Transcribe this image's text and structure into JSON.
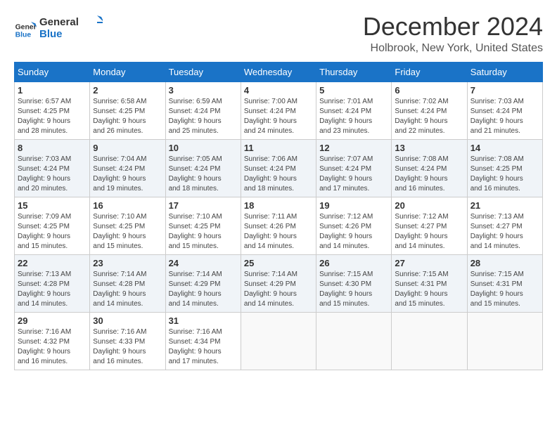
{
  "header": {
    "logo_line1": "General",
    "logo_line2": "Blue",
    "main_title": "December 2024",
    "subtitle": "Holbrook, New York, United States"
  },
  "calendar": {
    "days_of_week": [
      "Sunday",
      "Monday",
      "Tuesday",
      "Wednesday",
      "Thursday",
      "Friday",
      "Saturday"
    ],
    "weeks": [
      [
        {
          "day": 1,
          "info": "Sunrise: 6:57 AM\nSunset: 4:25 PM\nDaylight: 9 hours\nand 28 minutes."
        },
        {
          "day": 2,
          "info": "Sunrise: 6:58 AM\nSunset: 4:25 PM\nDaylight: 9 hours\nand 26 minutes."
        },
        {
          "day": 3,
          "info": "Sunrise: 6:59 AM\nSunset: 4:24 PM\nDaylight: 9 hours\nand 25 minutes."
        },
        {
          "day": 4,
          "info": "Sunrise: 7:00 AM\nSunset: 4:24 PM\nDaylight: 9 hours\nand 24 minutes."
        },
        {
          "day": 5,
          "info": "Sunrise: 7:01 AM\nSunset: 4:24 PM\nDaylight: 9 hours\nand 23 minutes."
        },
        {
          "day": 6,
          "info": "Sunrise: 7:02 AM\nSunset: 4:24 PM\nDaylight: 9 hours\nand 22 minutes."
        },
        {
          "day": 7,
          "info": "Sunrise: 7:03 AM\nSunset: 4:24 PM\nDaylight: 9 hours\nand 21 minutes."
        }
      ],
      [
        {
          "day": 8,
          "info": "Sunrise: 7:03 AM\nSunset: 4:24 PM\nDaylight: 9 hours\nand 20 minutes."
        },
        {
          "day": 9,
          "info": "Sunrise: 7:04 AM\nSunset: 4:24 PM\nDaylight: 9 hours\nand 19 minutes."
        },
        {
          "day": 10,
          "info": "Sunrise: 7:05 AM\nSunset: 4:24 PM\nDaylight: 9 hours\nand 18 minutes."
        },
        {
          "day": 11,
          "info": "Sunrise: 7:06 AM\nSunset: 4:24 PM\nDaylight: 9 hours\nand 18 minutes."
        },
        {
          "day": 12,
          "info": "Sunrise: 7:07 AM\nSunset: 4:24 PM\nDaylight: 9 hours\nand 17 minutes."
        },
        {
          "day": 13,
          "info": "Sunrise: 7:08 AM\nSunset: 4:24 PM\nDaylight: 9 hours\nand 16 minutes."
        },
        {
          "day": 14,
          "info": "Sunrise: 7:08 AM\nSunset: 4:25 PM\nDaylight: 9 hours\nand 16 minutes."
        }
      ],
      [
        {
          "day": 15,
          "info": "Sunrise: 7:09 AM\nSunset: 4:25 PM\nDaylight: 9 hours\nand 15 minutes."
        },
        {
          "day": 16,
          "info": "Sunrise: 7:10 AM\nSunset: 4:25 PM\nDaylight: 9 hours\nand 15 minutes."
        },
        {
          "day": 17,
          "info": "Sunrise: 7:10 AM\nSunset: 4:25 PM\nDaylight: 9 hours\nand 15 minutes."
        },
        {
          "day": 18,
          "info": "Sunrise: 7:11 AM\nSunset: 4:26 PM\nDaylight: 9 hours\nand 14 minutes."
        },
        {
          "day": 19,
          "info": "Sunrise: 7:12 AM\nSunset: 4:26 PM\nDaylight: 9 hours\nand 14 minutes."
        },
        {
          "day": 20,
          "info": "Sunrise: 7:12 AM\nSunset: 4:27 PM\nDaylight: 9 hours\nand 14 minutes."
        },
        {
          "day": 21,
          "info": "Sunrise: 7:13 AM\nSunset: 4:27 PM\nDaylight: 9 hours\nand 14 minutes."
        }
      ],
      [
        {
          "day": 22,
          "info": "Sunrise: 7:13 AM\nSunset: 4:28 PM\nDaylight: 9 hours\nand 14 minutes."
        },
        {
          "day": 23,
          "info": "Sunrise: 7:14 AM\nSunset: 4:28 PM\nDaylight: 9 hours\nand 14 minutes."
        },
        {
          "day": 24,
          "info": "Sunrise: 7:14 AM\nSunset: 4:29 PM\nDaylight: 9 hours\nand 14 minutes."
        },
        {
          "day": 25,
          "info": "Sunrise: 7:14 AM\nSunset: 4:29 PM\nDaylight: 9 hours\nand 14 minutes."
        },
        {
          "day": 26,
          "info": "Sunrise: 7:15 AM\nSunset: 4:30 PM\nDaylight: 9 hours\nand 15 minutes."
        },
        {
          "day": 27,
          "info": "Sunrise: 7:15 AM\nSunset: 4:31 PM\nDaylight: 9 hours\nand 15 minutes."
        },
        {
          "day": 28,
          "info": "Sunrise: 7:15 AM\nSunset: 4:31 PM\nDaylight: 9 hours\nand 15 minutes."
        }
      ],
      [
        {
          "day": 29,
          "info": "Sunrise: 7:16 AM\nSunset: 4:32 PM\nDaylight: 9 hours\nand 16 minutes."
        },
        {
          "day": 30,
          "info": "Sunrise: 7:16 AM\nSunset: 4:33 PM\nDaylight: 9 hours\nand 16 minutes."
        },
        {
          "day": 31,
          "info": "Sunrise: 7:16 AM\nSunset: 4:34 PM\nDaylight: 9 hours\nand 17 minutes."
        },
        null,
        null,
        null,
        null
      ]
    ]
  }
}
